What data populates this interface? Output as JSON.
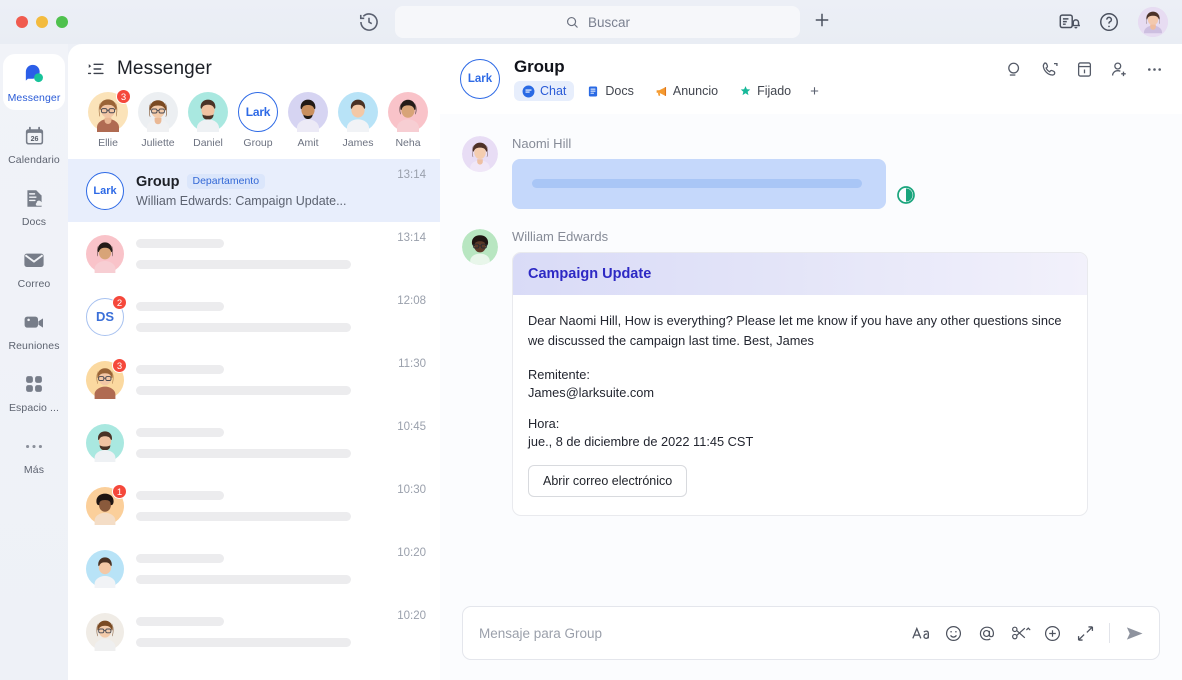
{
  "window": {
    "traffic_lights": [
      "close",
      "minimize",
      "maximize"
    ]
  },
  "titlebar": {
    "history_icon": "history-clock-icon",
    "search": {
      "placeholder": "Buscar",
      "icon": "search-icon"
    },
    "add_icon": "plus-icon",
    "notifications_icon": "notifications-bell-icon",
    "help_icon": "help-question-icon",
    "avatar": "user-avatar"
  },
  "rail": {
    "items": [
      {
        "label": "Messenger",
        "icon": "messenger-bubble-icon",
        "active": true
      },
      {
        "label": "Calendario",
        "icon": "calendar-26-icon",
        "active": false
      },
      {
        "label": "Docs",
        "icon": "docs-cloud-icon",
        "active": false
      },
      {
        "label": "Correo",
        "icon": "mail-envelope-icon",
        "active": false
      },
      {
        "label": "Reuniones",
        "icon": "video-camera-icon",
        "active": false
      },
      {
        "label": "Espacio ...",
        "icon": "grid-apps-icon",
        "active": false
      },
      {
        "label": "Más",
        "icon": "ellipsis-icon",
        "active": false
      }
    ]
  },
  "list_panel": {
    "title": "Messenger",
    "title_icon": "list-filter-icon",
    "stories": [
      {
        "name": "Ellie",
        "badge": "3",
        "avatar_bg": "#fbe3b9",
        "type": "photo"
      },
      {
        "name": "Juliette",
        "badge": "",
        "avatar_bg": "#eceff2",
        "type": "photo"
      },
      {
        "name": "Daniel",
        "badge": "",
        "avatar_bg": "#a9e8e0",
        "type": "photo"
      },
      {
        "name": "Group",
        "badge": "",
        "avatar_bg": "#ffffff",
        "type": "lark",
        "logo": "Lark"
      },
      {
        "name": "Amit",
        "badge": "",
        "avatar_bg": "#d6d4f2",
        "type": "photo"
      },
      {
        "name": "James",
        "badge": "",
        "avatar_bg": "#b8e3f7",
        "type": "photo"
      },
      {
        "name": "Neha",
        "badge": "",
        "avatar_bg": "#f9c3c9",
        "type": "photo"
      }
    ],
    "rows": [
      {
        "type": "full",
        "selected": true,
        "avatar_type": "lark",
        "logo": "Lark",
        "name": "Group",
        "tag": "Departamento",
        "snippet": "William Edwards: Campaign Update...",
        "time": "13:14",
        "badge": ""
      },
      {
        "type": "skeleton",
        "selected": false,
        "avatar_type": "photo",
        "avatar_bg": "#f9c3c9",
        "time": "13:14",
        "badge": ""
      },
      {
        "type": "skeleton",
        "selected": false,
        "avatar_type": "initials",
        "initials": "DS",
        "time": "12:08",
        "badge": "2"
      },
      {
        "type": "skeleton",
        "selected": false,
        "avatar_type": "photo",
        "avatar_bg": "#fbd9a0",
        "time": "11:30",
        "badge": "3"
      },
      {
        "type": "skeleton",
        "selected": false,
        "avatar_type": "photo",
        "avatar_bg": "#a9e8e0",
        "time": "10:45",
        "badge": ""
      },
      {
        "type": "skeleton",
        "selected": false,
        "avatar_type": "photo",
        "avatar_bg": "#fbcf9a",
        "time": "10:30",
        "badge": "1"
      },
      {
        "type": "skeleton",
        "selected": false,
        "avatar_type": "photo",
        "avatar_bg": "#b8e3f7",
        "time": "10:20",
        "badge": ""
      },
      {
        "type": "skeleton",
        "selected": false,
        "avatar_type": "photo",
        "avatar_bg": "#f0ece6",
        "time": "10:20",
        "badge": ""
      }
    ]
  },
  "conversation": {
    "logo": "Lark",
    "name": "Group",
    "tabs": [
      {
        "label": "Chat",
        "icon": "chat-bubble-icon",
        "active": true
      },
      {
        "label": "Docs",
        "icon": "doc-blue-icon",
        "active": false
      },
      {
        "label": "Anuncio",
        "icon": "megaphone-icon",
        "active": false
      },
      {
        "label": "Fijado",
        "icon": "pin-star-icon",
        "active": false
      }
    ],
    "tab_add": "+",
    "actions": [
      {
        "icon": "search-in-chat-icon"
      },
      {
        "icon": "phone-call-icon"
      },
      {
        "icon": "calendar-panel-icon"
      },
      {
        "icon": "add-member-icon"
      },
      {
        "icon": "more-options-icon"
      }
    ],
    "messages": [
      {
        "sender": "Naomi Hill",
        "kind": "placeholder-bubble",
        "avatar_bg": "#e8ddf5",
        "translate_icon": "translate-status-icon"
      },
      {
        "sender": "William Edwards",
        "kind": "card",
        "avatar_bg": "#b8e6c1",
        "card": {
          "title": "Campaign Update",
          "body": "Dear Naomi Hill, How is everything? Please let me know if you have any other questions since we discussed the campaign last time. Best, James",
          "sender_label": "Remitente:",
          "sender_value": "James@larksuite.com",
          "time_label": "Hora:",
          "time_value": "jue., 8 de diciembre de 2022 11:45 CST",
          "button": "Abrir correo electrónico"
        }
      }
    ],
    "composer": {
      "placeholder": "Mensaje para Group",
      "tools": [
        {
          "icon": "text-format-Aa-icon"
        },
        {
          "icon": "emoji-smiley-icon"
        },
        {
          "icon": "mention-at-icon"
        },
        {
          "icon": "scissors-clip-icon"
        },
        {
          "icon": "add-plus-circle-icon"
        },
        {
          "icon": "expand-arrows-icon"
        }
      ],
      "send_icon": "send-paperplane-icon"
    }
  },
  "colors": {
    "accent": "#2a5bd7",
    "badge_red": "#f5483b",
    "card_title": "#2d29c4",
    "selected_row": "#e8eefc",
    "translate_green": "#19a47c"
  }
}
